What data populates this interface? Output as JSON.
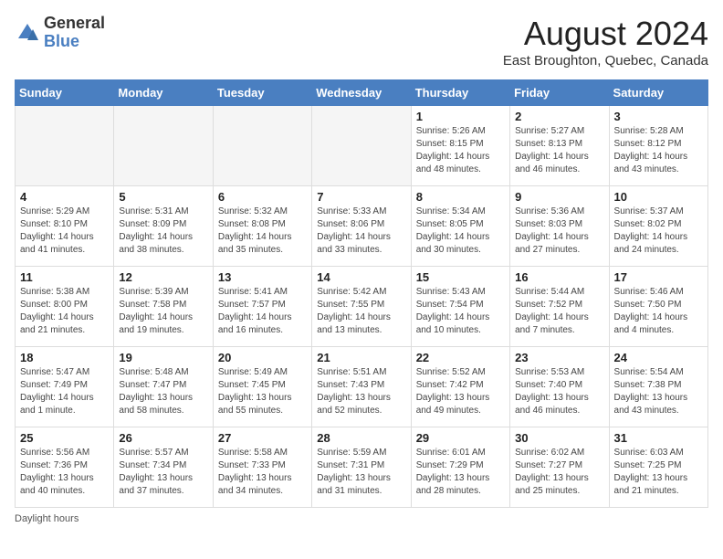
{
  "header": {
    "logo_general": "General",
    "logo_blue": "Blue",
    "month_year": "August 2024",
    "location": "East Broughton, Quebec, Canada"
  },
  "days_of_week": [
    "Sunday",
    "Monday",
    "Tuesday",
    "Wednesday",
    "Thursday",
    "Friday",
    "Saturday"
  ],
  "weeks": [
    [
      {
        "day": "",
        "empty": true
      },
      {
        "day": "",
        "empty": true
      },
      {
        "day": "",
        "empty": true
      },
      {
        "day": "",
        "empty": true
      },
      {
        "day": "1",
        "sunrise": "5:26 AM",
        "sunset": "8:15 PM",
        "daylight": "14 hours and 48 minutes."
      },
      {
        "day": "2",
        "sunrise": "5:27 AM",
        "sunset": "8:13 PM",
        "daylight": "14 hours and 46 minutes."
      },
      {
        "day": "3",
        "sunrise": "5:28 AM",
        "sunset": "8:12 PM",
        "daylight": "14 hours and 43 minutes."
      }
    ],
    [
      {
        "day": "4",
        "sunrise": "5:29 AM",
        "sunset": "8:10 PM",
        "daylight": "14 hours and 41 minutes."
      },
      {
        "day": "5",
        "sunrise": "5:31 AM",
        "sunset": "8:09 PM",
        "daylight": "14 hours and 38 minutes."
      },
      {
        "day": "6",
        "sunrise": "5:32 AM",
        "sunset": "8:08 PM",
        "daylight": "14 hours and 35 minutes."
      },
      {
        "day": "7",
        "sunrise": "5:33 AM",
        "sunset": "8:06 PM",
        "daylight": "14 hours and 33 minutes."
      },
      {
        "day": "8",
        "sunrise": "5:34 AM",
        "sunset": "8:05 PM",
        "daylight": "14 hours and 30 minutes."
      },
      {
        "day": "9",
        "sunrise": "5:36 AM",
        "sunset": "8:03 PM",
        "daylight": "14 hours and 27 minutes."
      },
      {
        "day": "10",
        "sunrise": "5:37 AM",
        "sunset": "8:02 PM",
        "daylight": "14 hours and 24 minutes."
      }
    ],
    [
      {
        "day": "11",
        "sunrise": "5:38 AM",
        "sunset": "8:00 PM",
        "daylight": "14 hours and 21 minutes."
      },
      {
        "day": "12",
        "sunrise": "5:39 AM",
        "sunset": "7:58 PM",
        "daylight": "14 hours and 19 minutes."
      },
      {
        "day": "13",
        "sunrise": "5:41 AM",
        "sunset": "7:57 PM",
        "daylight": "14 hours and 16 minutes."
      },
      {
        "day": "14",
        "sunrise": "5:42 AM",
        "sunset": "7:55 PM",
        "daylight": "14 hours and 13 minutes."
      },
      {
        "day": "15",
        "sunrise": "5:43 AM",
        "sunset": "7:54 PM",
        "daylight": "14 hours and 10 minutes."
      },
      {
        "day": "16",
        "sunrise": "5:44 AM",
        "sunset": "7:52 PM",
        "daylight": "14 hours and 7 minutes."
      },
      {
        "day": "17",
        "sunrise": "5:46 AM",
        "sunset": "7:50 PM",
        "daylight": "14 hours and 4 minutes."
      }
    ],
    [
      {
        "day": "18",
        "sunrise": "5:47 AM",
        "sunset": "7:49 PM",
        "daylight": "14 hours and 1 minute."
      },
      {
        "day": "19",
        "sunrise": "5:48 AM",
        "sunset": "7:47 PM",
        "daylight": "13 hours and 58 minutes."
      },
      {
        "day": "20",
        "sunrise": "5:49 AM",
        "sunset": "7:45 PM",
        "daylight": "13 hours and 55 minutes."
      },
      {
        "day": "21",
        "sunrise": "5:51 AM",
        "sunset": "7:43 PM",
        "daylight": "13 hours and 52 minutes."
      },
      {
        "day": "22",
        "sunrise": "5:52 AM",
        "sunset": "7:42 PM",
        "daylight": "13 hours and 49 minutes."
      },
      {
        "day": "23",
        "sunrise": "5:53 AM",
        "sunset": "7:40 PM",
        "daylight": "13 hours and 46 minutes."
      },
      {
        "day": "24",
        "sunrise": "5:54 AM",
        "sunset": "7:38 PM",
        "daylight": "13 hours and 43 minutes."
      }
    ],
    [
      {
        "day": "25",
        "sunrise": "5:56 AM",
        "sunset": "7:36 PM",
        "daylight": "13 hours and 40 minutes."
      },
      {
        "day": "26",
        "sunrise": "5:57 AM",
        "sunset": "7:34 PM",
        "daylight": "13 hours and 37 minutes."
      },
      {
        "day": "27",
        "sunrise": "5:58 AM",
        "sunset": "7:33 PM",
        "daylight": "13 hours and 34 minutes."
      },
      {
        "day": "28",
        "sunrise": "5:59 AM",
        "sunset": "7:31 PM",
        "daylight": "13 hours and 31 minutes."
      },
      {
        "day": "29",
        "sunrise": "6:01 AM",
        "sunset": "7:29 PM",
        "daylight": "13 hours and 28 minutes."
      },
      {
        "day": "30",
        "sunrise": "6:02 AM",
        "sunset": "7:27 PM",
        "daylight": "13 hours and 25 minutes."
      },
      {
        "day": "31",
        "sunrise": "6:03 AM",
        "sunset": "7:25 PM",
        "daylight": "13 hours and 21 minutes."
      }
    ]
  ],
  "footer": {
    "daylight_label": "Daylight hours"
  }
}
